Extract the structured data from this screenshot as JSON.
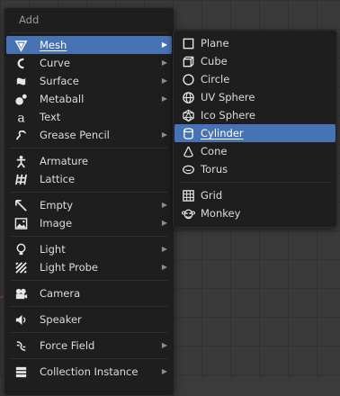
{
  "add_menu": {
    "title": "Add",
    "items": [
      {
        "label": "Mesh",
        "icon": "mesh-icon",
        "submenu": true
      },
      {
        "label": "Curve",
        "icon": "curve-icon",
        "submenu": true
      },
      {
        "label": "Surface",
        "icon": "surface-icon",
        "submenu": true
      },
      {
        "label": "Metaball",
        "icon": "metaball-icon",
        "submenu": true
      },
      {
        "label": "Text",
        "icon": "text-icon",
        "submenu": false
      },
      {
        "label": "Grease Pencil",
        "icon": "grease-pencil-icon",
        "submenu": true
      },
      {
        "label": "Armature",
        "icon": "armature-icon",
        "submenu": false
      },
      {
        "label": "Lattice",
        "icon": "lattice-icon",
        "submenu": false
      },
      {
        "label": "Empty",
        "icon": "empty-icon",
        "submenu": true
      },
      {
        "label": "Image",
        "icon": "image-icon",
        "submenu": true
      },
      {
        "label": "Light",
        "icon": "light-icon",
        "submenu": true
      },
      {
        "label": "Light Probe",
        "icon": "light-probe-icon",
        "submenu": true
      },
      {
        "label": "Camera",
        "icon": "camera-icon",
        "submenu": false
      },
      {
        "label": "Speaker",
        "icon": "speaker-icon",
        "submenu": false
      },
      {
        "label": "Force Field",
        "icon": "force-field-icon",
        "submenu": true
      },
      {
        "label": "Collection Instance",
        "icon": "collection-instance-icon",
        "submenu": true
      }
    ]
  },
  "mesh_menu": {
    "items": [
      {
        "label": "Plane",
        "icon": "plane-icon"
      },
      {
        "label": "Cube",
        "icon": "cube-icon"
      },
      {
        "label": "Circle",
        "icon": "circle-icon"
      },
      {
        "label": "UV Sphere",
        "icon": "uv-sphere-icon"
      },
      {
        "label": "Ico Sphere",
        "icon": "ico-sphere-icon"
      },
      {
        "label": "Cylinder",
        "icon": "cylinder-icon"
      },
      {
        "label": "Cone",
        "icon": "cone-icon"
      },
      {
        "label": "Torus",
        "icon": "torus-icon"
      },
      {
        "label": "Grid",
        "icon": "grid-icon"
      },
      {
        "label": "Monkey",
        "icon": "monkey-icon"
      }
    ]
  },
  "colors": {
    "highlight": "#4772b3",
    "menu_bg": "#1e1e1e",
    "text": "#dcdcdc",
    "title_text": "#9a9a9a"
  }
}
